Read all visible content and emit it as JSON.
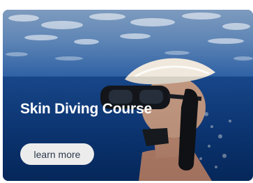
{
  "card": {
    "title": "Skin Diving Course",
    "button_label": "learn more"
  },
  "colors": {
    "surface": "#6f92bd",
    "deep_water": "#0b3f8c",
    "title_text": "#ffffff",
    "button_bg": "#ececec",
    "button_text": "#2c3a4c"
  }
}
